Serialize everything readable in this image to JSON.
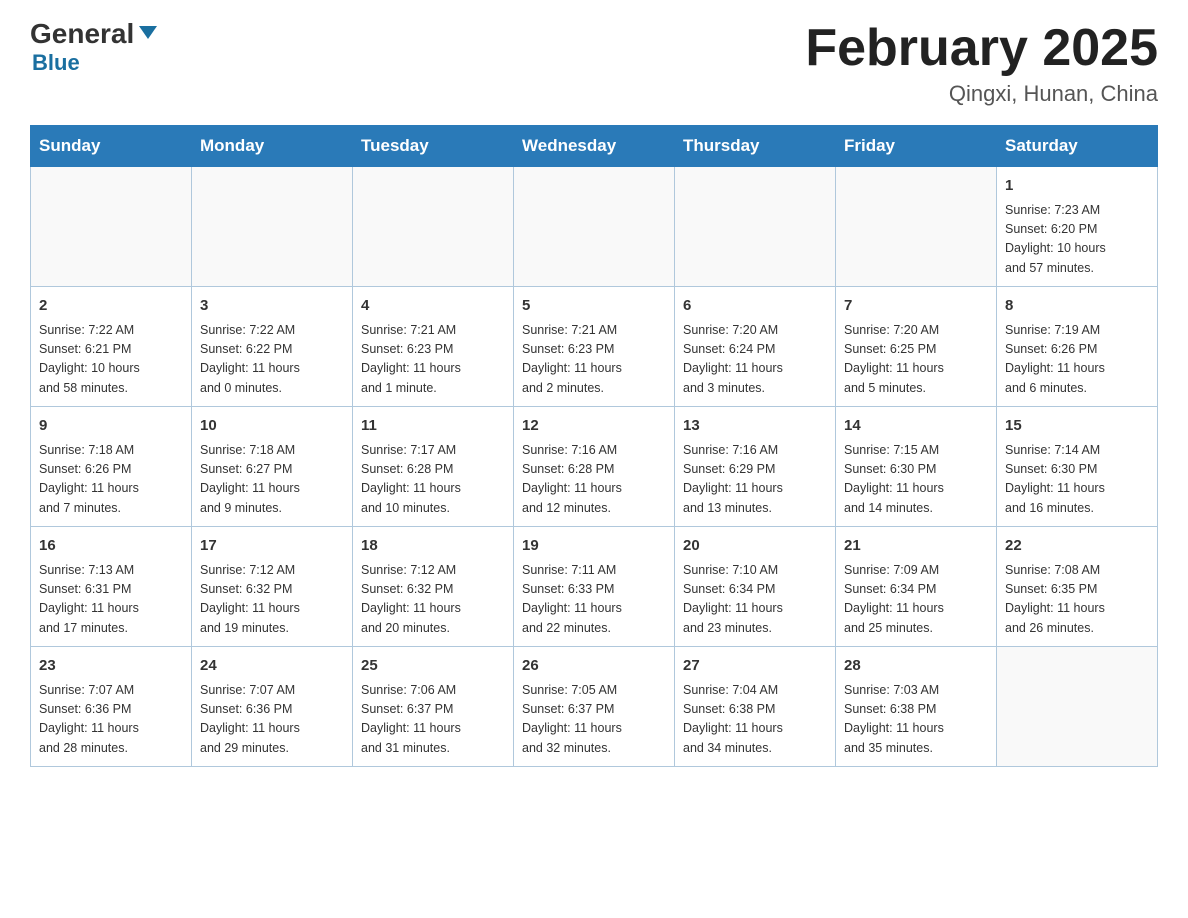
{
  "logo": {
    "general": "General",
    "blue": "Blue",
    "triangle": "▼"
  },
  "title": "February 2025",
  "location": "Qingxi, Hunan, China",
  "weekdays": [
    "Sunday",
    "Monday",
    "Tuesday",
    "Wednesday",
    "Thursday",
    "Friday",
    "Saturday"
  ],
  "weeks": [
    [
      {
        "day": "",
        "info": ""
      },
      {
        "day": "",
        "info": ""
      },
      {
        "day": "",
        "info": ""
      },
      {
        "day": "",
        "info": ""
      },
      {
        "day": "",
        "info": ""
      },
      {
        "day": "",
        "info": ""
      },
      {
        "day": "1",
        "info": "Sunrise: 7:23 AM\nSunset: 6:20 PM\nDaylight: 10 hours\nand 57 minutes."
      }
    ],
    [
      {
        "day": "2",
        "info": "Sunrise: 7:22 AM\nSunset: 6:21 PM\nDaylight: 10 hours\nand 58 minutes."
      },
      {
        "day": "3",
        "info": "Sunrise: 7:22 AM\nSunset: 6:22 PM\nDaylight: 11 hours\nand 0 minutes."
      },
      {
        "day": "4",
        "info": "Sunrise: 7:21 AM\nSunset: 6:23 PM\nDaylight: 11 hours\nand 1 minute."
      },
      {
        "day": "5",
        "info": "Sunrise: 7:21 AM\nSunset: 6:23 PM\nDaylight: 11 hours\nand 2 minutes."
      },
      {
        "day": "6",
        "info": "Sunrise: 7:20 AM\nSunset: 6:24 PM\nDaylight: 11 hours\nand 3 minutes."
      },
      {
        "day": "7",
        "info": "Sunrise: 7:20 AM\nSunset: 6:25 PM\nDaylight: 11 hours\nand 5 minutes."
      },
      {
        "day": "8",
        "info": "Sunrise: 7:19 AM\nSunset: 6:26 PM\nDaylight: 11 hours\nand 6 minutes."
      }
    ],
    [
      {
        "day": "9",
        "info": "Sunrise: 7:18 AM\nSunset: 6:26 PM\nDaylight: 11 hours\nand 7 minutes."
      },
      {
        "day": "10",
        "info": "Sunrise: 7:18 AM\nSunset: 6:27 PM\nDaylight: 11 hours\nand 9 minutes."
      },
      {
        "day": "11",
        "info": "Sunrise: 7:17 AM\nSunset: 6:28 PM\nDaylight: 11 hours\nand 10 minutes."
      },
      {
        "day": "12",
        "info": "Sunrise: 7:16 AM\nSunset: 6:28 PM\nDaylight: 11 hours\nand 12 minutes."
      },
      {
        "day": "13",
        "info": "Sunrise: 7:16 AM\nSunset: 6:29 PM\nDaylight: 11 hours\nand 13 minutes."
      },
      {
        "day": "14",
        "info": "Sunrise: 7:15 AM\nSunset: 6:30 PM\nDaylight: 11 hours\nand 14 minutes."
      },
      {
        "day": "15",
        "info": "Sunrise: 7:14 AM\nSunset: 6:30 PM\nDaylight: 11 hours\nand 16 minutes."
      }
    ],
    [
      {
        "day": "16",
        "info": "Sunrise: 7:13 AM\nSunset: 6:31 PM\nDaylight: 11 hours\nand 17 minutes."
      },
      {
        "day": "17",
        "info": "Sunrise: 7:12 AM\nSunset: 6:32 PM\nDaylight: 11 hours\nand 19 minutes."
      },
      {
        "day": "18",
        "info": "Sunrise: 7:12 AM\nSunset: 6:32 PM\nDaylight: 11 hours\nand 20 minutes."
      },
      {
        "day": "19",
        "info": "Sunrise: 7:11 AM\nSunset: 6:33 PM\nDaylight: 11 hours\nand 22 minutes."
      },
      {
        "day": "20",
        "info": "Sunrise: 7:10 AM\nSunset: 6:34 PM\nDaylight: 11 hours\nand 23 minutes."
      },
      {
        "day": "21",
        "info": "Sunrise: 7:09 AM\nSunset: 6:34 PM\nDaylight: 11 hours\nand 25 minutes."
      },
      {
        "day": "22",
        "info": "Sunrise: 7:08 AM\nSunset: 6:35 PM\nDaylight: 11 hours\nand 26 minutes."
      }
    ],
    [
      {
        "day": "23",
        "info": "Sunrise: 7:07 AM\nSunset: 6:36 PM\nDaylight: 11 hours\nand 28 minutes."
      },
      {
        "day": "24",
        "info": "Sunrise: 7:07 AM\nSunset: 6:36 PM\nDaylight: 11 hours\nand 29 minutes."
      },
      {
        "day": "25",
        "info": "Sunrise: 7:06 AM\nSunset: 6:37 PM\nDaylight: 11 hours\nand 31 minutes."
      },
      {
        "day": "26",
        "info": "Sunrise: 7:05 AM\nSunset: 6:37 PM\nDaylight: 11 hours\nand 32 minutes."
      },
      {
        "day": "27",
        "info": "Sunrise: 7:04 AM\nSunset: 6:38 PM\nDaylight: 11 hours\nand 34 minutes."
      },
      {
        "day": "28",
        "info": "Sunrise: 7:03 AM\nSunset: 6:38 PM\nDaylight: 11 hours\nand 35 minutes."
      },
      {
        "day": "",
        "info": ""
      }
    ]
  ]
}
